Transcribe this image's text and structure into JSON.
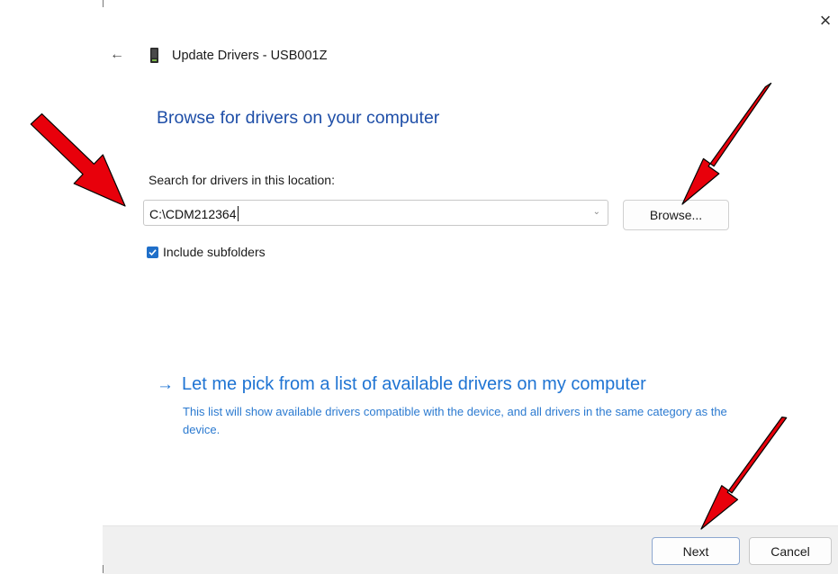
{
  "window": {
    "close_glyph": "×"
  },
  "header": {
    "back_glyph": "←",
    "title": "Update Drivers - USB001Z",
    "device_icon": "usb-device-icon"
  },
  "heading": "Browse for drivers on your computer",
  "search": {
    "label": "Search for drivers in this location:",
    "value": "C:\\CDM212364",
    "browse_label": "Browse..."
  },
  "include_subfolders": {
    "label": "Include subfolders",
    "checked": true
  },
  "pick_option": {
    "arrow": "→",
    "title": "Let me pick from a list of available drivers on my computer",
    "description": "This list will show available drivers compatible with the device, and all drivers in the same category as the device."
  },
  "footer": {
    "next_label": "Next",
    "cancel_label": "Cancel"
  },
  "colors": {
    "heading": "#1f4fa8",
    "link": "#1f74d3",
    "checkbox": "#1f6fc9",
    "arrow_fill": "#e8000b",
    "footer_bg": "#f0f0f0"
  }
}
